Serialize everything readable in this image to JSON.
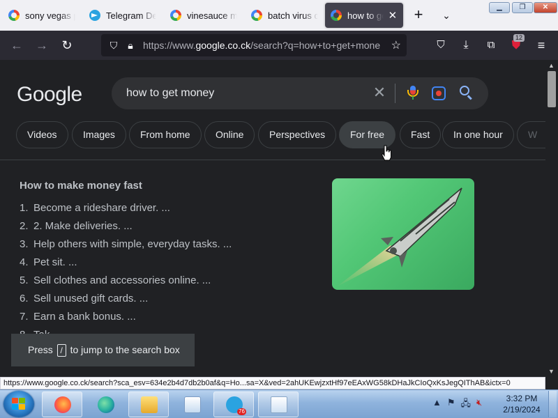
{
  "tabs": [
    {
      "label": "sony vegas pro",
      "icon": "google-icon",
      "active": false
    },
    {
      "label": "Telegram Desktop",
      "icon": "telegram-icon",
      "active": false
    },
    {
      "label": "vinesauce meme",
      "icon": "google-icon",
      "active": false
    },
    {
      "label": "batch virus download",
      "icon": "google-icon",
      "active": false
    },
    {
      "label": "how to get money",
      "icon": "google-icon",
      "active": true
    }
  ],
  "url": {
    "prefix": "https://www.",
    "host": "google.co.ck",
    "rest": "/search?q=how+to+get+money&sca_esv"
  },
  "extension_badge": "12",
  "search": {
    "query": "how to get money",
    "logo": "Google"
  },
  "chips": [
    "Videos",
    "Images",
    "From home",
    "Online",
    "Perspectives",
    "For free",
    "Fast",
    "In one hour",
    "W"
  ],
  "snippet": {
    "heading": "How to make money fast",
    "steps": [
      {
        "num": "1.",
        "text": "Become a rideshare driver. ..."
      },
      {
        "num": "2.",
        "text": "2. Make deliveries. ..."
      },
      {
        "num": "3.",
        "text": "Help others with simple, everyday tasks. ..."
      },
      {
        "num": "4.",
        "text": "Pet sit. ..."
      },
      {
        "num": "5.",
        "text": "Sell clothes and accessories online. ..."
      },
      {
        "num": "6.",
        "text": "Sell unused gift cards. ..."
      },
      {
        "num": "7.",
        "text": "Earn a bank bonus. ..."
      },
      {
        "num": "8.",
        "text": "Tak..."
      }
    ]
  },
  "toast": {
    "before": "Press",
    "key": "/",
    "after": "to jump to the search box"
  },
  "status_url": "https://www.google.co.ck/search?sca_esv=634e2b4d7db2b0af&q=Ho...sa=X&ved=2ahUKEwjzxtHf97eEAxWG58kDHaJkCIoQxKsJegQIThAB&ictx=0",
  "taskbar": {
    "telegram_badge": "76",
    "time": "3:32 PM",
    "date": "2/19/2024"
  },
  "colors": {
    "page_bg": "#202124",
    "toolbar_bg": "#2b2a33",
    "tabstrip_bg": "#f0f0f4",
    "link_blue": "#8ab4f8"
  }
}
